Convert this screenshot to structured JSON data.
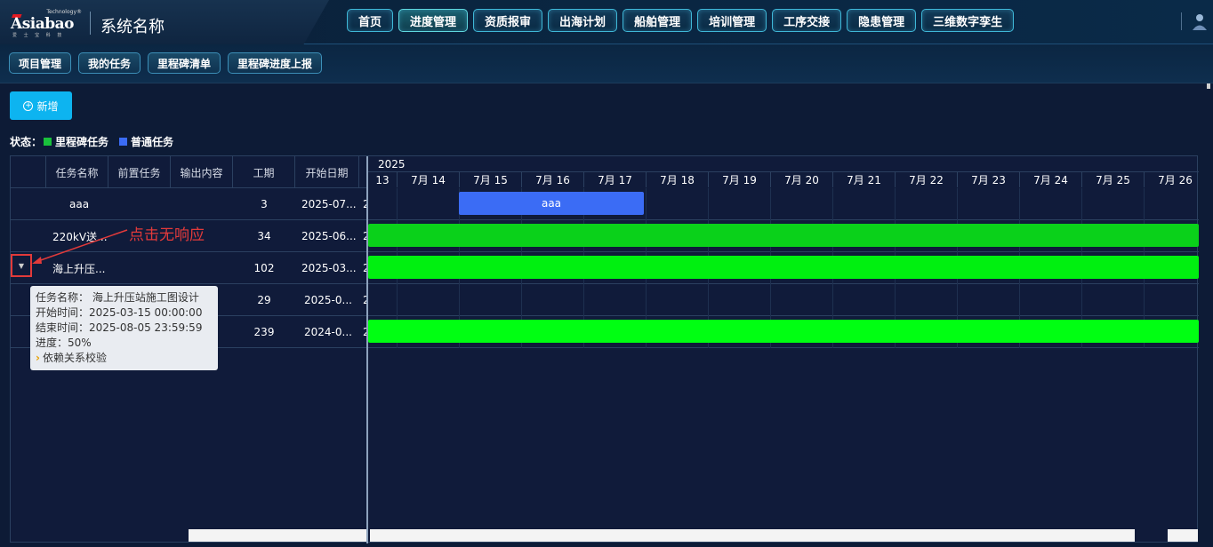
{
  "header": {
    "brand_tech": "Technology®",
    "brand_word": "Asiabao",
    "brand_sub": "爱 士 宝 科 技",
    "system_title": "系统名称",
    "nav": [
      "首页",
      "进度管理",
      "资质报审",
      "出海计划",
      "船舶管理",
      "培训管理",
      "工序交接",
      "隐患管理",
      "三维数字孪生"
    ],
    "active_nav": "进度管理"
  },
  "subnav": [
    "项目管理",
    "我的任务",
    "里程碑清单",
    "里程碑进度上报"
  ],
  "toolbar": {
    "add_label": "新增"
  },
  "legend": {
    "prefix": "状态：",
    "milestone_label": "里程碑任务",
    "milestone_color": "#19c13c",
    "normal_label": "普通任务",
    "normal_color": "#3b6cf5"
  },
  "grid": {
    "columns": [
      "任务名称",
      "前置任务",
      "输出内容",
      "工期",
      "开始日期"
    ],
    "rows": [
      {
        "name": "aaa",
        "duration": "3",
        "start": "2025-07...",
        "cut": "2"
      },
      {
        "name": "220kV送...",
        "duration": "34",
        "start": "2025-06...",
        "cut": "2"
      },
      {
        "name": "海上升压...",
        "duration": "102",
        "start": "2025-03...",
        "cut": "2"
      },
      {
        "name": "",
        "duration": "29",
        "start": "2025-0...",
        "cut": "2"
      },
      {
        "name": "",
        "duration": "239",
        "start": "2024-0...",
        "cut": "2"
      }
    ]
  },
  "timeline": {
    "year": "2025",
    "partial_first": "13",
    "dates": [
      "7月 14",
      "7月 15",
      "7月 16",
      "7月 17",
      "7月 18",
      "7月 19",
      "7月 20",
      "7月 21",
      "7月 22",
      "7月 23",
      "7月 24",
      "7月 25",
      "7月 26"
    ],
    "bars": [
      {
        "row": 0,
        "label": "aaa",
        "color": "#3b6cf5"
      },
      {
        "row": 1,
        "label": "",
        "color": "#0ad11a"
      },
      {
        "row": 2,
        "label": "",
        "color": "#00f010"
      },
      {
        "row": 4,
        "label": "",
        "color": "#00ff12"
      }
    ]
  },
  "annotation": {
    "text": "点击无响应",
    "color": "#e23a3a"
  },
  "tooltip": {
    "name_line": "任务名称： 海上升压站施工图设计",
    "start_line": "开始时间：2025-03-15 00:00:00",
    "end_line": "结束时间：2025-08-05 23:59:59",
    "progress_line": "进度：50%",
    "link_label": "依赖关系校验"
  }
}
